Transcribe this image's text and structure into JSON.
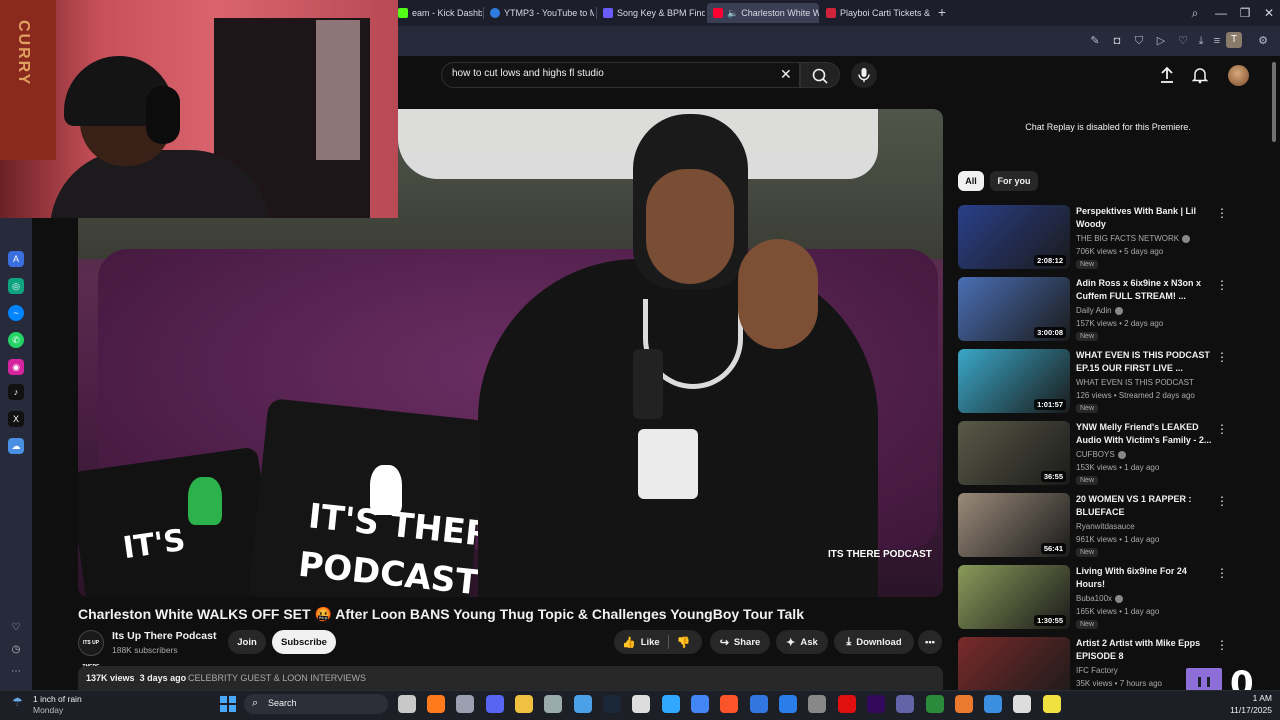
{
  "browser": {
    "tabs": [
      {
        "label": "eam - Kick Dashboard",
        "fav_color": "#53fc18"
      },
      {
        "label": "YTMP3 - YouTube to MP3",
        "fav_color": "#2f7de1"
      },
      {
        "label": "Song Key & BPM Finder |",
        "fav_color": "#6a5cff"
      },
      {
        "label": "Charleston White WA",
        "fav_color": "#ff0033",
        "active": true
      },
      {
        "label": "Playboi Carti Tickets & 20",
        "fav_color": "#d0243a"
      }
    ],
    "new_tab": "+",
    "controls": {
      "search": "⌕",
      "minimize": "—",
      "restore": "❐",
      "close": "✕"
    },
    "profile_initial": "T"
  },
  "youtube": {
    "search": {
      "query": "how to cut lows and highs fl studio",
      "clear": "✕"
    },
    "video": {
      "title": "Charleston White WALKS OFF SET 🤬 After Loon BANS Young Thug Topic & Challenges YoungBoy Tour Talk",
      "pillow_text_1": "IT'S",
      "pillow_text_2": "IT'S THERE",
      "pillow_text_3": "PODCAST",
      "watermark": "ITS THERE PODCAST"
    },
    "channel": {
      "name": "Its Up There Podcast",
      "subscribers": "188K subscribers",
      "avatar_text": "ITS UP THERE"
    },
    "actions": {
      "join": "Join",
      "subscribe": "Subscribe",
      "like": "Like",
      "share": "Share",
      "ask": "Ask",
      "download": "Download",
      "more": "•••"
    },
    "description": {
      "views": "137K views",
      "age": "3 days ago",
      "tags": "CELEBRITY GUEST & LOON INTERVIEWS"
    },
    "chat_replay": "Chat Replay is disabled for this Premiere.",
    "chips": [
      "All",
      "For you"
    ],
    "recommendations": [
      {
        "title": "Perspektives With Bank | Lil Woody",
        "channel": "THE BIG FACTS NETWORK",
        "verified": true,
        "meta": "706K views • 5 days ago",
        "badge": "New",
        "duration": "2:08:12",
        "thumb": "#2a3f8a"
      },
      {
        "title": "Adin Ross x 6ix9ine x N3on x Cuffem FULL STREAM! ...",
        "channel": "Daily Adin",
        "verified": true,
        "meta": "157K views • 2 days ago",
        "badge": "New",
        "duration": "3:00:08",
        "thumb": "#4a6fb5"
      },
      {
        "title": "WHAT EVEN IS THIS PODCAST EP.15 OUR FIRST LIVE ...",
        "channel": "WHAT EVEN IS THIS PODCAST",
        "verified": false,
        "meta": "126 views • Streamed 2 days ago",
        "badge": "New",
        "duration": "1:01:57",
        "thumb": "#3aa8c8"
      },
      {
        "title": "YNW Melly Friend's LEAKED Audio With Victim's Family - 2...",
        "channel": "CUFBOYS",
        "verified": true,
        "meta": "153K views • 1 day ago",
        "badge": "New",
        "duration": "36:55",
        "thumb": "#5a5a48"
      },
      {
        "title": "20 WOMEN VS 1 RAPPER : BLUEFACE",
        "channel": "Ryanwitdasauce",
        "verified": false,
        "meta": "961K views • 1 day ago",
        "badge": "New",
        "duration": "56:41",
        "thumb": "#9a8a7a"
      },
      {
        "title": "Living With 6ix9ine For 24 Hours!",
        "channel": "Buba100x",
        "verified": true,
        "meta": "165K views • 1 day ago",
        "badge": "New",
        "duration": "1:30:55",
        "thumb": "#8a9a5a"
      },
      {
        "title": "Artist 2 Artist with Mike Epps EPISODE 8",
        "channel": "IFC Factory",
        "verified": false,
        "meta": "35K views • 7 hours ago",
        "badge": "",
        "duration": "",
        "thumb": "#7a2a2a"
      }
    ]
  },
  "overlay": {
    "viewer_count": "0",
    "webcam_banner": "CURRY"
  },
  "taskbar": {
    "weather": {
      "line1": "1 inch of rain",
      "line2": "Monday"
    },
    "search": "Search",
    "clock": {
      "time": "1 AM",
      "date": "11/17/2025"
    },
    "apps": [
      "#c8c8c8",
      "#ff7a1a",
      "#9aa0b0",
      "#5865f2",
      "#f0c040",
      "#9aa",
      "#4ba0e8",
      "#1b2838",
      "#ddd",
      "#31a8ff",
      "#4285f4",
      "#fb542b",
      "#3277e0",
      "#2b7de9",
      "#888",
      "#e01010",
      "#31085a",
      "#6264a7",
      "#2a8c3a",
      "#e97a2e",
      "#3b8ee0",
      "#ddd",
      "#f0e040"
    ]
  }
}
